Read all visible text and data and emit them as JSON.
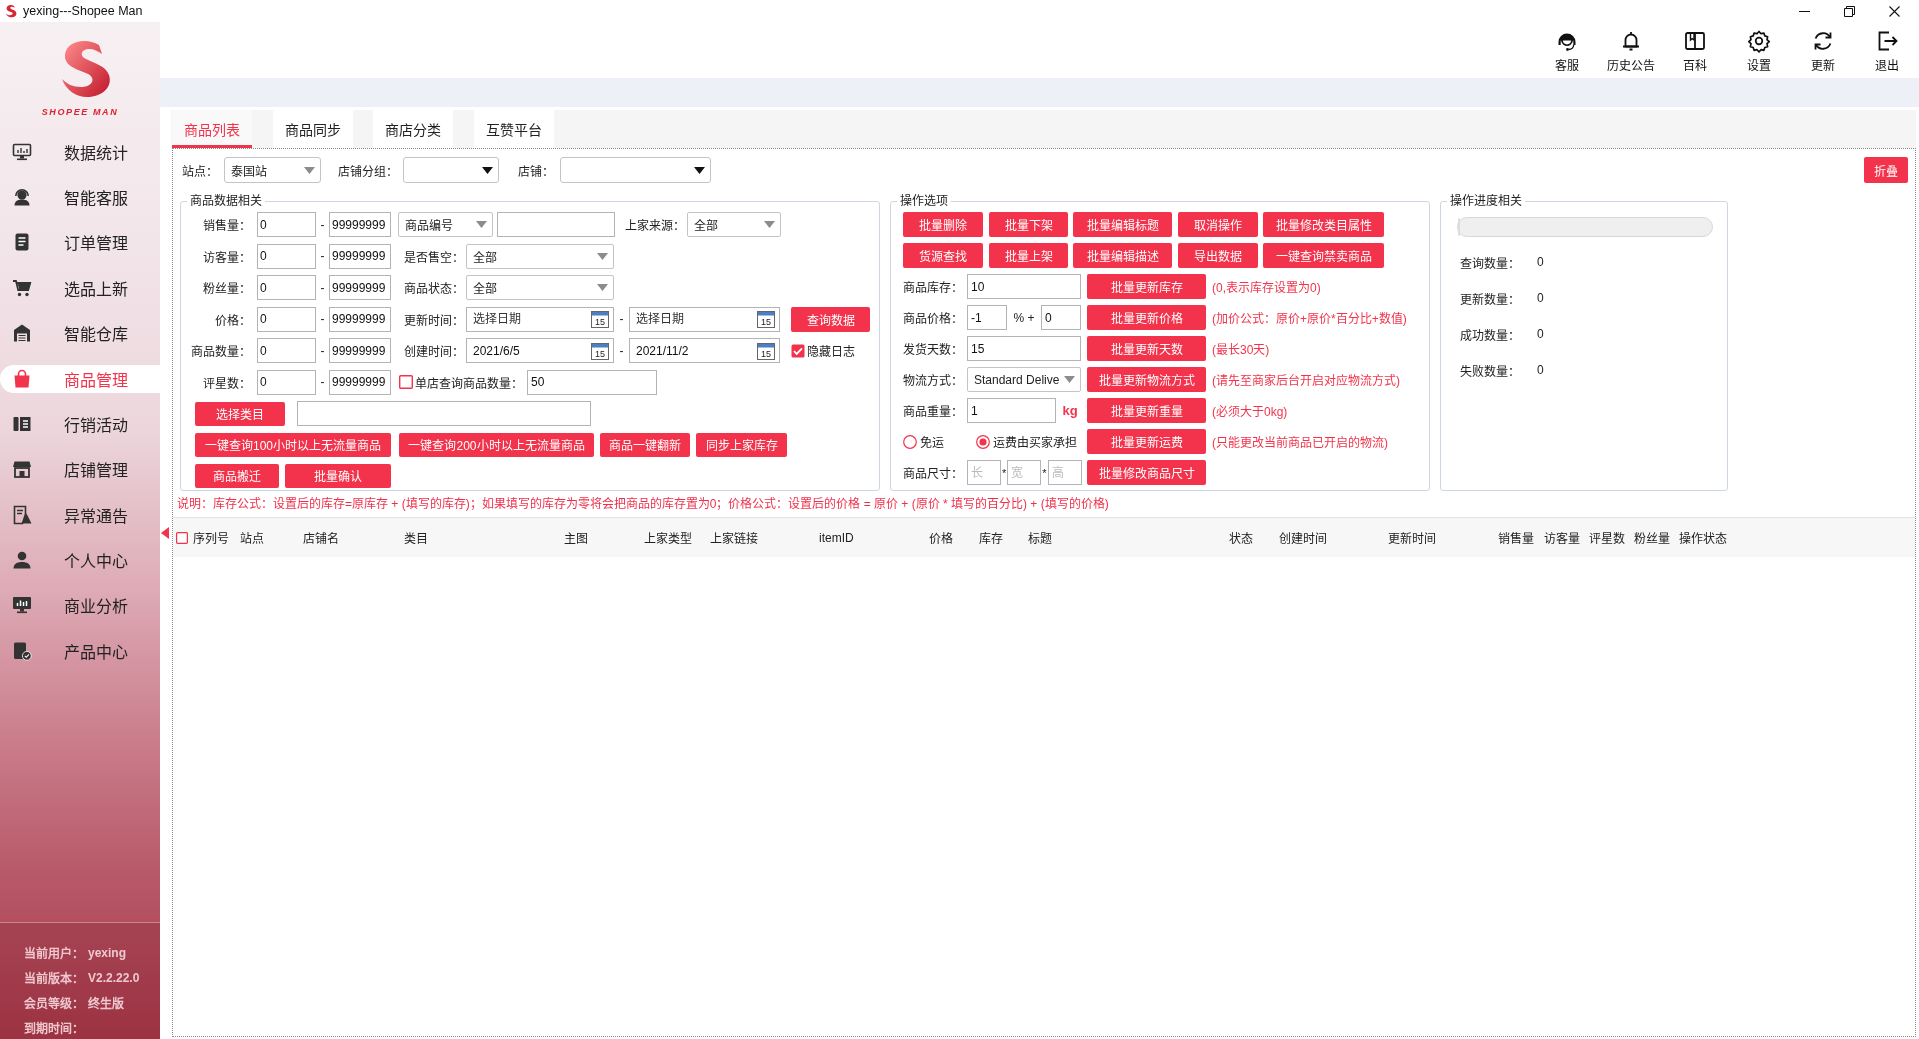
{
  "window": {
    "title": "yexing---Shopee Man"
  },
  "sidebar": {
    "logo_text": "SHOPEE MAN",
    "items": [
      {
        "label": "数据统计",
        "kind": "monitor",
        "selected": false
      },
      {
        "label": "智能客服",
        "kind": "agent",
        "selected": false
      },
      {
        "label": "订单管理",
        "kind": "document",
        "selected": false
      },
      {
        "label": "选品上新",
        "kind": "cart",
        "selected": false
      },
      {
        "label": "智能仓库",
        "kind": "warehouse",
        "selected": false
      },
      {
        "label": "商品管理",
        "kind": "bag",
        "selected": true
      },
      {
        "label": "行销活动",
        "kind": "ticket",
        "selected": false
      },
      {
        "label": "店铺管理",
        "kind": "store",
        "selected": false
      },
      {
        "label": "异常通告",
        "kind": "notice",
        "selected": false
      },
      {
        "label": "个人中心",
        "kind": "person",
        "selected": false
      },
      {
        "label": "商业分析",
        "kind": "chart",
        "selected": false
      },
      {
        "label": "产品中心",
        "kind": "product",
        "selected": false
      }
    ],
    "account": [
      {
        "label": "当前用户：",
        "value": "yexing"
      },
      {
        "label": "当前版本：",
        "value": "V2.2.22.0"
      },
      {
        "label": "会员等级：",
        "value": "终生版"
      },
      {
        "label": "到期时间："
      }
    ]
  },
  "toolbar": [
    {
      "label": "客服",
      "kind": "headset"
    },
    {
      "label": "历史公告",
      "kind": "bell"
    },
    {
      "label": "百科",
      "kind": "book"
    },
    {
      "label": "设置",
      "kind": "gear"
    },
    {
      "label": "更新",
      "kind": "refresh"
    },
    {
      "label": "退出",
      "kind": "logout"
    }
  ],
  "tabs": [
    {
      "label": "商品列表",
      "selected": true
    },
    {
      "label": "商品同步",
      "selected": false
    },
    {
      "label": "商店分类",
      "selected": false
    },
    {
      "label": "互赞平台",
      "selected": false
    }
  ],
  "filters": {
    "site": {
      "label": "站点：",
      "value": "泰国站"
    },
    "shop_group": {
      "label": "店铺分组："
    },
    "shop": {
      "label": "店铺："
    },
    "collapse_button": "折叠"
  },
  "product_data": {
    "title": "商品数据相关",
    "ranges": [
      {
        "label": "销售量：",
        "min": "0",
        "separator": "-",
        "max": "99999999"
      },
      {
        "label": "访客量：",
        "min": "0",
        "separator": "-",
        "max": "99999999"
      },
      {
        "label": "粉丝量：",
        "min": "0",
        "separator": "-",
        "max": "99999999"
      },
      {
        "label": "价格：",
        "min": "0",
        "separator": "-",
        "max": "99999999"
      },
      {
        "label": "商品数量：",
        "min": "0",
        "separator": "-",
        "max": "99999999"
      },
      {
        "label": "评星数：",
        "min": "0",
        "separator": "-",
        "max": "99999999"
      }
    ],
    "number_type": {
      "value": "商品编号"
    },
    "source": {
      "label": "上家来源：",
      "value": "全部"
    },
    "sold_out": {
      "label": "是否售空：",
      "value": "全部"
    },
    "status": {
      "label": "商品状态：",
      "value": "全部"
    },
    "update_time": {
      "label": "更新时间：",
      "from": {
        "placeholder": "选择日期",
        "calendar_day": "15"
      },
      "separator": "-",
      "to": {
        "placeholder": "选择日期",
        "calendar_day": "15"
      }
    },
    "query_button": "查询数据",
    "create_time": {
      "label": "创建时间：",
      "from": {
        "value": "2021/6/5",
        "calendar_day": "15"
      },
      "separator": "-",
      "to": {
        "value": "2021/11/2",
        "calendar_day": "15"
      }
    },
    "hide_log": {
      "label": "隐藏日志",
      "checked": true
    },
    "single_shop": {
      "label": "单店查询商品数量：",
      "checked": false,
      "value": "50"
    },
    "category_button": "选择类目",
    "button_rows": [
      [
        "一键查询100小时以上无流量商品",
        "一键查询200小时以上无流量商品",
        "商品一键翻新",
        "同步上家库存"
      ],
      [
        "商品搬迁",
        "批量确认"
      ]
    ]
  },
  "operations": {
    "title": "操作选项",
    "button_rows": [
      [
        "批量删除",
        "批量下架",
        "批量编辑标题",
        "取消操作",
        "批量修改类目属性"
      ],
      [
        "货源查找",
        "批量上架",
        "批量编辑描述",
        "导出数据",
        "一键查询禁卖商品"
      ]
    ],
    "settings": [
      {
        "kind": "text",
        "label": "商品库存：",
        "value": "10",
        "button": "批量更新库存",
        "note": "(0,表示库存设置为0)"
      },
      {
        "kind": "price",
        "label": "商品价格：",
        "percent": "-1",
        "separator": "% +",
        "add": "0",
        "button": "批量更新价格",
        "note": "(加价公式：原价+原价*百分比+数值)"
      },
      {
        "kind": "text",
        "label": "发货天数：",
        "value": "15",
        "button": "批量更新天数",
        "note": "(最长30天)"
      },
      {
        "kind": "select",
        "label": "物流方式：",
        "value": "Standard Delive",
        "button": "批量更新物流方式",
        "note": "(请先至商家后台开启对应物流方式)"
      },
      {
        "kind": "weight",
        "label": "商品重量：",
        "value": "1",
        "unit": "kg",
        "button": "批量更新重量",
        "note": "(必须大于0kg)"
      },
      {
        "kind": "radios",
        "options": [
          {
            "label": "免运",
            "selected": false
          },
          {
            "label": "运费由买家承担",
            "selected": true
          }
        ],
        "button": "批量更新运费",
        "note": "(只能更改当前商品已开启的物流)"
      },
      {
        "kind": "size",
        "label": "商品尺寸：",
        "fields": [
          {
            "placeholder": "长",
            "after": "*"
          },
          {
            "placeholder": "宽",
            "after": "*"
          },
          {
            "placeholder": "高"
          }
        ],
        "button": "批量修改商品尺寸"
      }
    ]
  },
  "progress": {
    "title": "操作进度相关",
    "level": 0,
    "stats": [
      {
        "label": "查询数量：",
        "value": "0"
      },
      {
        "label": "更新数量：",
        "value": "0"
      },
      {
        "label": "成功数量：",
        "value": "0"
      },
      {
        "label": "失败数量：",
        "value": "0"
      }
    ]
  },
  "note": "说明：库存公式：设置后的库存=原库存 + (填写的库存)；如果填写的库存为零将会把商品的库存置为0；价格公式：设置后的价格 = 原价 + (原价 * 填写的百分比) + (填写的价格)",
  "table": {
    "select_all": {
      "checked": false
    },
    "columns": [
      "序列号",
      "站点",
      "店铺名",
      "类目",
      "主图",
      "上家类型",
      "上家链接",
      "itemID",
      "价格",
      "库存",
      "标题",
      "状态",
      "创建时间",
      "更新时间",
      "销售量",
      "访客量",
      "评星数",
      "粉丝量",
      "操作状态"
    ]
  }
}
